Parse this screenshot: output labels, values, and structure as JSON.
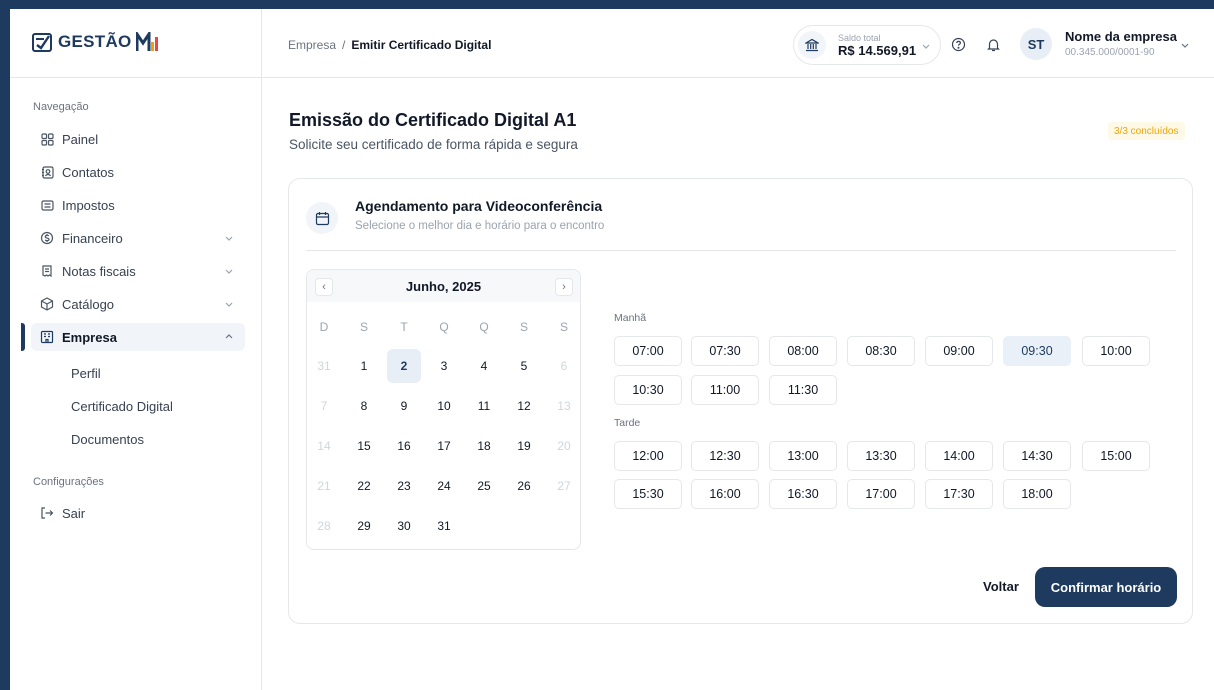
{
  "brand": {
    "name": "GESTÃO",
    "suffix": "MEI"
  },
  "sidebar": {
    "nav_label": "Navegação",
    "items": [
      {
        "label": "Painel"
      },
      {
        "label": "Contatos"
      },
      {
        "label": "Impostos"
      },
      {
        "label": "Financeiro"
      },
      {
        "label": "Notas fiscais"
      },
      {
        "label": "Catálogo"
      },
      {
        "label": "Empresa"
      }
    ],
    "sub_items": [
      {
        "label": "Perfil"
      },
      {
        "label": "Certificado Digital"
      },
      {
        "label": "Documentos"
      }
    ],
    "config_label": "Configurações",
    "logout_label": "Sair"
  },
  "header": {
    "breadcrumb_root": "Empresa",
    "breadcrumb_sep": "/",
    "breadcrumb_current": "Emitir Certificado Digital",
    "balance_label": "Saldo total",
    "balance_value": "R$ 14.569,91",
    "avatar_initials": "ST",
    "company_name": "Nome da empresa",
    "company_doc": "00.345.000/0001-90"
  },
  "page": {
    "title": "Emissão do Certificado Digital A1",
    "subtitle": "Solicite seu certificado de forma rápida e segura",
    "progress_badge": "3/3 concluídos"
  },
  "card": {
    "title": "Agendamento para Videoconferência",
    "subtitle": "Selecione o melhor dia e horário para o encontro"
  },
  "calendar": {
    "month_label": "Junho, 2025",
    "prev": "‹",
    "next": "›",
    "weekdays": [
      "D",
      "S",
      "T",
      "Q",
      "Q",
      "S",
      "S"
    ],
    "selected_day": "2",
    "weeks": [
      [
        "31",
        "1",
        "2",
        "3",
        "4",
        "5",
        "6"
      ],
      [
        "7",
        "8",
        "9",
        "10",
        "11",
        "12",
        "13"
      ],
      [
        "14",
        "15",
        "16",
        "17",
        "18",
        "19",
        "20"
      ],
      [
        "21",
        "22",
        "23",
        "24",
        "25",
        "26",
        "27"
      ],
      [
        "28",
        "29",
        "30",
        "31",
        "",
        "",
        ""
      ]
    ]
  },
  "times": {
    "morning_label": "Manhã",
    "morning": [
      "07:00",
      "07:30",
      "08:00",
      "08:30",
      "09:00",
      "09:30",
      "10:00",
      "10:30",
      "11:00",
      "11:30"
    ],
    "afternoon_label": "Tarde",
    "afternoon": [
      "12:00",
      "12:30",
      "13:00",
      "13:30",
      "14:00",
      "14:30",
      "15:00",
      "15:30",
      "16:00",
      "16:30",
      "17:00",
      "17:30",
      "18:00"
    ],
    "selected": "09:30"
  },
  "actions": {
    "back_label": "Voltar",
    "confirm_label": "Confirmar horário"
  },
  "colors": {
    "primary": "#1e3a5f",
    "badge_bg": "#fef9e7",
    "badge_text": "#f0a500",
    "selected_bg": "#e8eef6"
  }
}
